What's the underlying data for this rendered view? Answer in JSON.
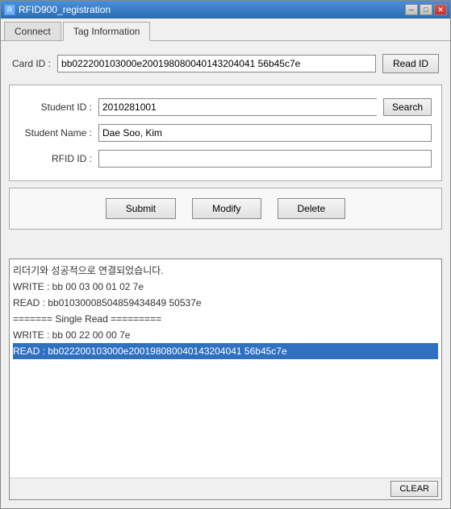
{
  "window": {
    "title": "RFID900_registration",
    "icon": "rfid-icon"
  },
  "tabs": [
    {
      "id": "connect",
      "label": "Connect",
      "active": false
    },
    {
      "id": "tag-info",
      "label": "Tag Information",
      "active": true
    }
  ],
  "card_id": {
    "label": "Card ID :",
    "value": "bb022200103000e200198080040143204041 56b45c7e",
    "read_btn": "Read ID"
  },
  "form": {
    "student_id_label": "Student ID :",
    "student_id_value": "2010281001",
    "search_btn": "Search",
    "student_name_label": "Student Name :",
    "student_name_value": "Dae Soo, Kim",
    "rfid_id_label": "RFID ID :",
    "rfid_id_value": ""
  },
  "actions": {
    "submit": "Submit",
    "modify": "Modify",
    "delete": "Delete"
  },
  "log": {
    "lines": [
      {
        "text": "리더기와 성공적으로 연결되었습니다.",
        "highlighted": false
      },
      {
        "text": "WRITE : bb 00 03 00 01 02 7e",
        "highlighted": false
      },
      {
        "text": "READ  : bb01030008504859434849 50537e",
        "highlighted": false
      },
      {
        "text": "======= Single Read =========",
        "highlighted": false
      },
      {
        "text": "WRITE : bb 00 22 00 00 7e",
        "highlighted": false
      },
      {
        "text": "READ  : bb022200103000e200198080040143204041 56b45c7e",
        "highlighted": true
      }
    ],
    "clear_btn": "CLEAR"
  }
}
